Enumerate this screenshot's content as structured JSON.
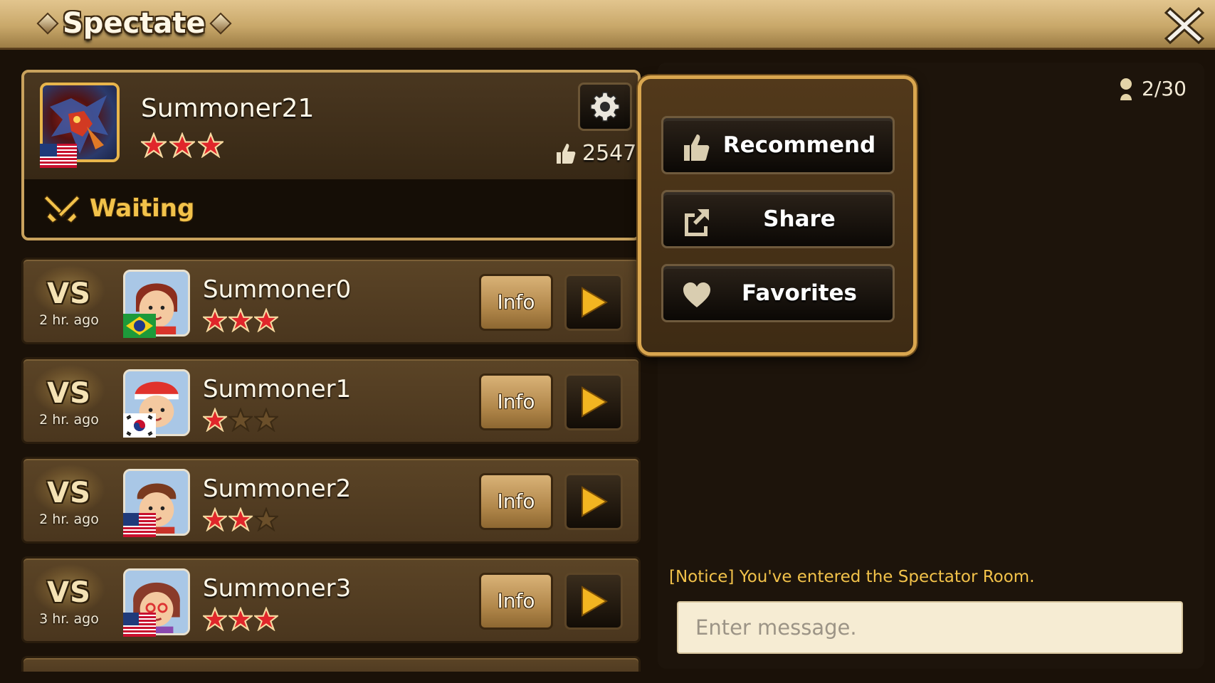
{
  "window": {
    "title": "Spectate",
    "close_icon": "close-x-icon"
  },
  "host": {
    "name": "Summoner21",
    "stars": 3,
    "likes": "2547",
    "status": "Waiting",
    "flag": "us-flag-icon",
    "settings_icon": "gear-icon"
  },
  "matches": [
    {
      "vs": "VS",
      "time": "2 hr. ago",
      "name": "Summoner0",
      "stars": 3,
      "flag": "brazil-flag-icon",
      "info_label": "Info"
    },
    {
      "vs": "VS",
      "time": "2 hr. ago",
      "name": "Summoner1",
      "stars": 1,
      "flag": "korea-flag-icon",
      "info_label": "Info"
    },
    {
      "vs": "VS",
      "time": "2 hr. ago",
      "name": "Summoner2",
      "stars": 2,
      "flag": "us-flag-icon",
      "info_label": "Info"
    },
    {
      "vs": "VS",
      "time": "3 hr. ago",
      "name": "Summoner3",
      "stars": 3,
      "flag": "us-flag-icon",
      "info_label": "Info"
    }
  ],
  "menu": {
    "recommend": "Recommend",
    "share": "Share",
    "favorites": "Favorites"
  },
  "room": {
    "count": "2/30"
  },
  "chat": {
    "notice": "[Notice] You've entered the Spectator Room.",
    "placeholder": "Enter message."
  },
  "colors": {
    "accent_gold": "#f2c24a",
    "star_red": "#e0262b",
    "frame_gold": "#d9a64f"
  }
}
